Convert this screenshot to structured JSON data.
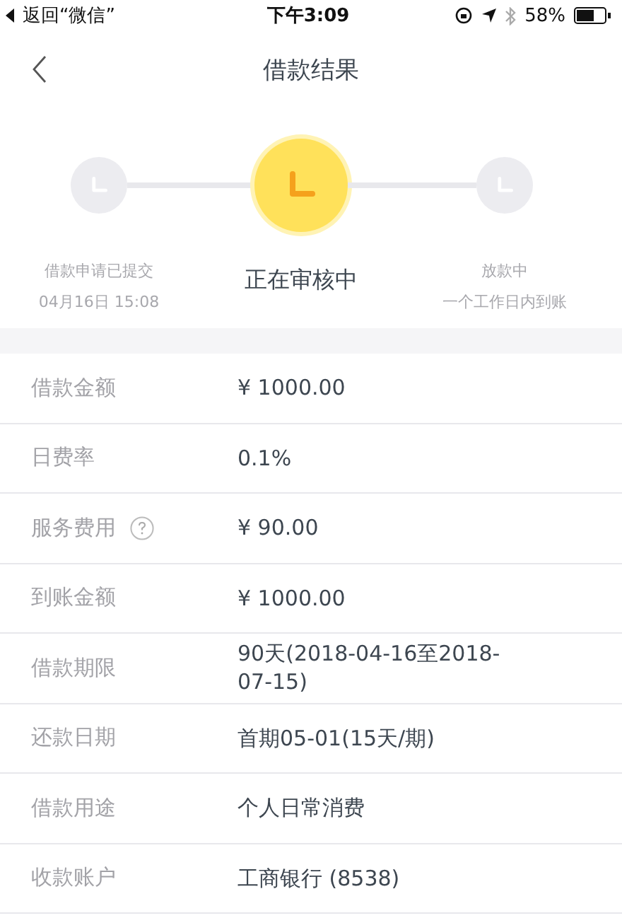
{
  "status_bar": {
    "back_label": "返回“微信”",
    "time": "下午3:09",
    "battery": "58%"
  },
  "nav": {
    "title": "借款结果"
  },
  "steps": [
    {
      "lines": [
        "借款申请已提交",
        "04月16日 15:08"
      ],
      "current": false
    },
    {
      "lines": [
        "正在审核中"
      ],
      "current": true
    },
    {
      "lines": [
        "放款中",
        "一个工作日内到账"
      ],
      "current": false
    }
  ],
  "rows": [
    {
      "label": "借款金额",
      "value": "¥ 1000.00",
      "help": false
    },
    {
      "label": "日费率",
      "value": "0.1%",
      "help": false
    },
    {
      "label": "服务费用",
      "value": "¥ 90.00",
      "help": true
    },
    {
      "label": "到账金额",
      "value": "¥ 1000.00",
      "help": false
    },
    {
      "label": "借款期限",
      "value": "90天(2018-04-16至2018-07-15)",
      "help": false
    },
    {
      "label": "还款日期",
      "value": "首期05-01(15天/期)",
      "help": false
    },
    {
      "label": "借款用途",
      "value": "个人日常消费",
      "help": false
    },
    {
      "label": "收款账户",
      "value": "工商银行 (8538)",
      "help": false
    }
  ]
}
